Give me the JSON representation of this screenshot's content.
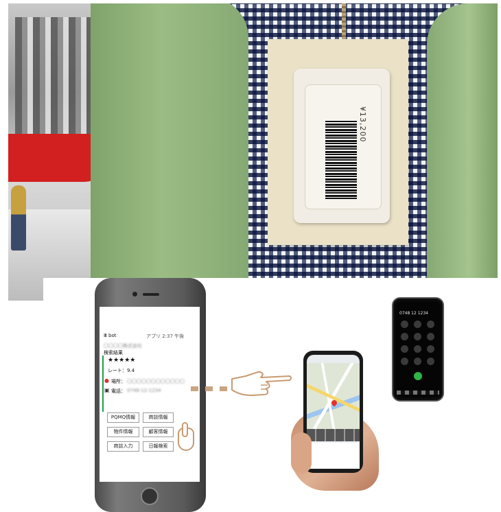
{
  "photo": {
    "tag_price": "¥13,200"
  },
  "phone_screen": {
    "status_left": "Ⅲ bot",
    "status_right": "アプリ 2:37 午後",
    "company": "〇〇〇〇株式会社",
    "section": "検索結果",
    "stars": "★★★★★",
    "rate": "レート：9.4",
    "address_label": "場所：",
    "address_value": "〇〇〇〇〇〇〇〇〇〇〇〇",
    "phone_label": "電話：",
    "phone_value": "0748-12-1234",
    "buttons": [
      "PQMQ情報",
      "商談情報",
      "物件情報",
      "顧客情報",
      "商談入力",
      "日報検索"
    ]
  },
  "dialer": {
    "number": "0748 12 1234"
  },
  "colors": {
    "accent_green": "#1aa04a",
    "hand_outline": "#c89a72",
    "pin_red": "#e0342b"
  }
}
